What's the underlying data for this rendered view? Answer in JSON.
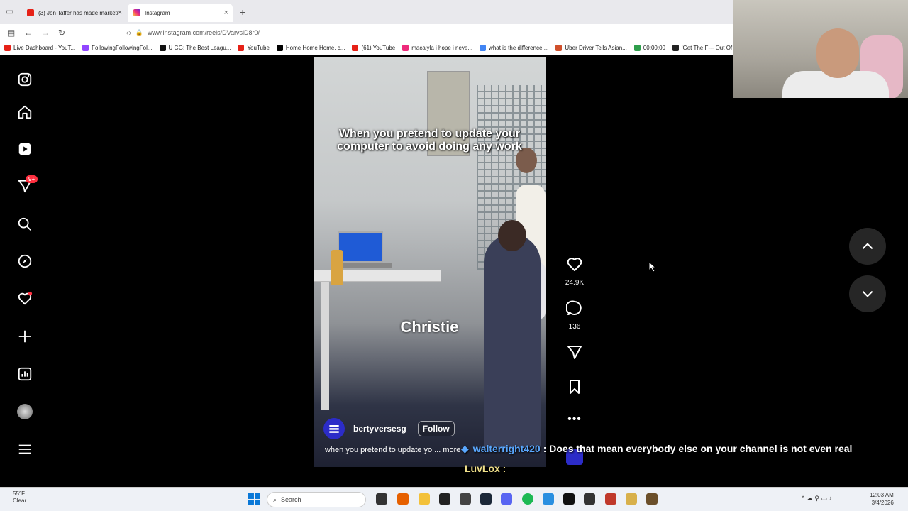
{
  "browser": {
    "tabs": [
      {
        "label": "(3) Jon Taffer has made marketi"
      },
      {
        "label": "Instagram"
      }
    ],
    "url": "www.instagram.com/reels/DVarvsiD8r0/",
    "bookmarks": [
      {
        "label": "Live Dashboard - YouT..."
      },
      {
        "label": "FollowingFollowingFol..."
      },
      {
        "label": "U GG: The Best Leagu..."
      },
      {
        "label": "YouTube"
      },
      {
        "label": "Home Home Home, c..."
      },
      {
        "label": "(61) YouTube"
      },
      {
        "label": "macaiyla i hope i neve..."
      },
      {
        "label": "what is the difference ..."
      },
      {
        "label": "Uber Driver Tells Asian..."
      },
      {
        "label": "00:00:00"
      },
      {
        "label": "'Get The F--- Out Of M"
      }
    ]
  },
  "sidebar": {
    "notifications_badge": "9+",
    "items": [
      "instagram-icon",
      "home-icon",
      "reels-icon",
      "messages-icon",
      "search-icon",
      "explore-icon",
      "notifications-icon",
      "create-icon",
      "dashboard-icon",
      "profile-avatar",
      "menu-icon"
    ]
  },
  "reel": {
    "caption_overlay": "When you pretend to update your computer to avoid doing any work",
    "name_overlay": "Christie",
    "username": "bertyversesg",
    "follow_label": "Follow",
    "description": "when you pretend to update yo ... more",
    "likes": "24.9K",
    "comments": "136"
  },
  "chat": {
    "user": "walterright420",
    "message": ": Does that mean everybody else on your channel is not even real",
    "user2": "LuvLox :"
  },
  "taskbar": {
    "weather_temp": "55°F",
    "weather_desc": "Clear",
    "search_placeholder": "Search",
    "time": "12:03 AM",
    "date": "3/4/2026"
  },
  "colors": {
    "instagram_accent": "#ff3040",
    "background": "#000000",
    "taskbar": "#eef1f6"
  }
}
